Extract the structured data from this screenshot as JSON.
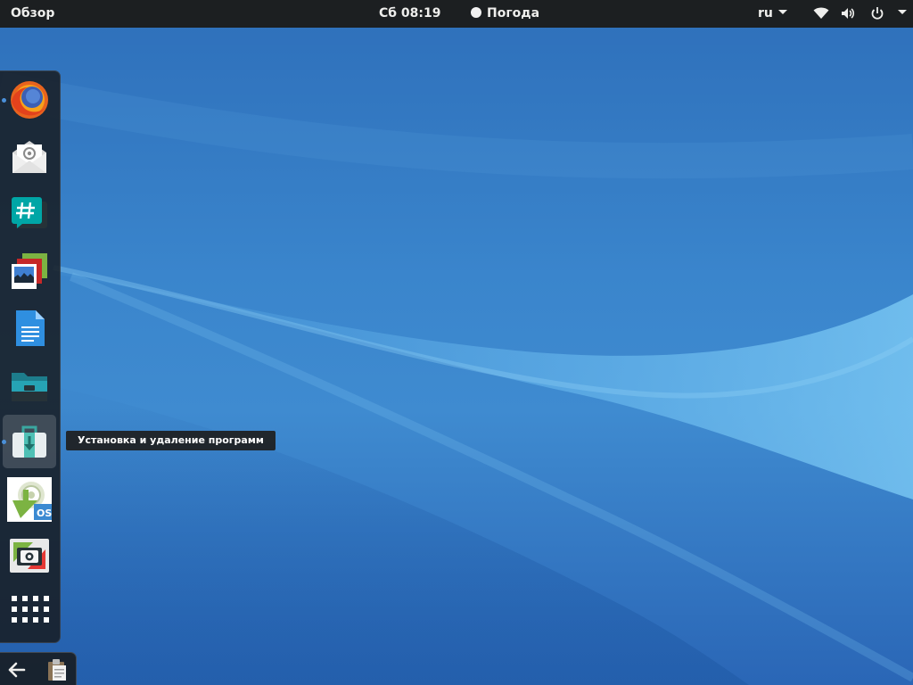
{
  "top_bar": {
    "activities_label": "Обзор",
    "clock": "Сб 08:19",
    "weather_label": "Погода",
    "keyboard_layout": "ru",
    "status_icons": [
      "wifi-icon",
      "volume-icon",
      "power-icon"
    ]
  },
  "dock": {
    "items": [
      {
        "icon": "firefox-icon",
        "running": true
      },
      {
        "icon": "mail-icon",
        "running": false
      },
      {
        "icon": "hexchat-icon",
        "running": false
      },
      {
        "icon": "image-viewer-icon",
        "running": false
      },
      {
        "icon": "text-document-icon",
        "running": false
      },
      {
        "icon": "file-manager-icon",
        "running": false
      },
      {
        "icon": "software-install-icon",
        "running": true
      },
      {
        "icon": "os-installer-icon",
        "running": false
      },
      {
        "icon": "camera-icon",
        "running": false
      },
      {
        "icon": "app-grid-icon",
        "running": false
      }
    ]
  },
  "tooltip": {
    "text": "Установка и удаление программ"
  },
  "bottom_tray": {
    "icons": [
      "back-arrow-icon",
      "clipboard-icon"
    ]
  },
  "colors": {
    "top_bar_bg": "#1c1f21",
    "wallpaper_blue": "#3a85cc",
    "dock_bg": "#181e24",
    "running_indicator": "#4a90d9"
  }
}
